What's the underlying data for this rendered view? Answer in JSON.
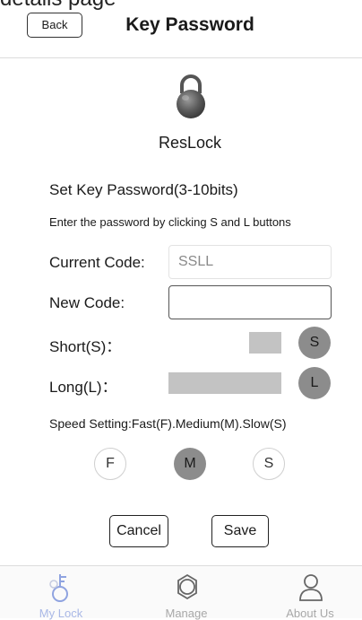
{
  "caption": "details page",
  "nav": {
    "back_label": "Back",
    "title": "Key Password"
  },
  "lock": {
    "name": "ResLock",
    "icon": "padlock-icon"
  },
  "form": {
    "section_title": "Set Key Password(3-10bits)",
    "hint": "Enter the password by clicking S and L buttons",
    "current_label": "Current Code:",
    "current_value": "SSLL",
    "new_label": "New Code:",
    "new_value": "",
    "short_label": "Short(S)：",
    "short_button": "S",
    "long_label": "Long(L)：",
    "long_button": "L"
  },
  "speed": {
    "label": "Speed Setting:Fast(F).Medium(M).Slow(S)",
    "options": [
      {
        "label": "F",
        "selected": false
      },
      {
        "label": "M",
        "selected": true
      },
      {
        "label": "S",
        "selected": false
      }
    ]
  },
  "actions": {
    "cancel_label": "Cancel",
    "save_label": "Save"
  },
  "tabs": [
    {
      "label": "My Lock",
      "icon": "key-icon",
      "active": true
    },
    {
      "label": "Manage",
      "icon": "gear-icon",
      "active": false
    },
    {
      "label": "About Us",
      "icon": "person-icon",
      "active": false
    }
  ],
  "colors": {
    "active_tab": "#a9b8e6",
    "selected_circle": "#8c8c8c",
    "bar": "#c3c3c3"
  }
}
